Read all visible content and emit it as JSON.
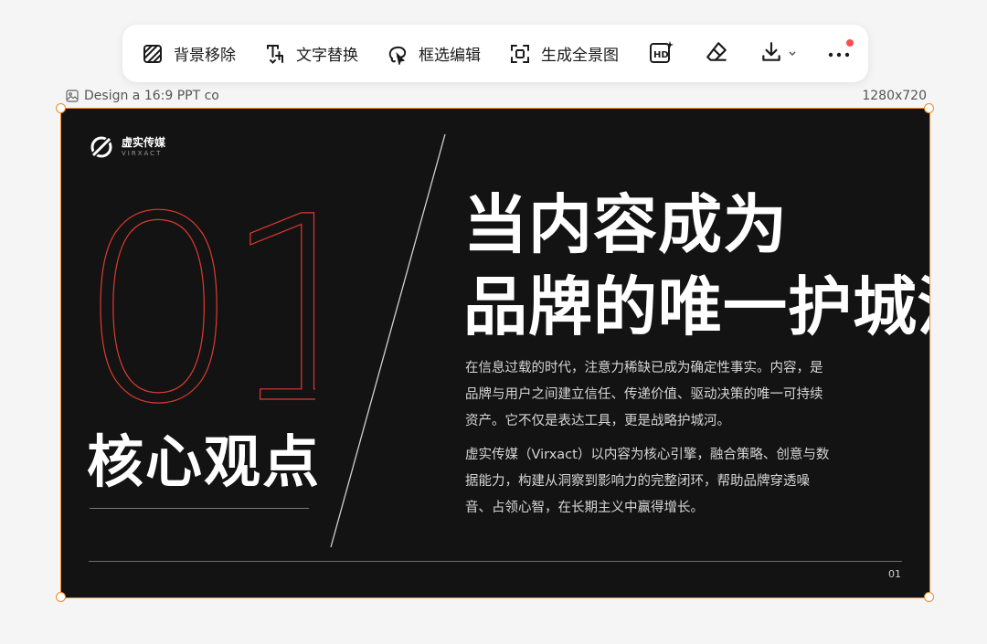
{
  "toolbar": {
    "remove_bg": "背景移除",
    "replace_text": "文字替换",
    "box_edit": "框选编辑",
    "panorama": "生成全景图",
    "hd_icon": "hd-icon",
    "eraser_icon": "eraser-icon",
    "download_icon": "download-icon",
    "more_icon": "more-icon",
    "notification_color": "#ff4d4f"
  },
  "frame": {
    "label": "Design a 16:9 PPT co",
    "size": "1280x720",
    "outline_color": "#f08a24"
  },
  "slide": {
    "logo_cn": "虚实传媒",
    "logo_en": "VIRXACT",
    "big_number": "01",
    "section_title": "核心观点",
    "headline_line1": "当内容成为",
    "headline_line2": "品牌的唯一护城河",
    "paragraph1": "在信息过载的时代，注意力稀缺已成为确定性事实。内容，是品牌与用户之间建立信任、传递价值、驱动决策的唯一可持续资产。它不仅是表达工具，更是战略护城河。",
    "paragraph2": "虚实传媒（Virxact）以内容为核心引擎，融合策略、创意与数据能力，构建从洞察到影响力的完整闭环，帮助品牌穿透噪音、占领心智，在长期主义中赢得增长。",
    "page_number": "01",
    "accent_color": "#e03a2f",
    "background_color": "#131313"
  }
}
